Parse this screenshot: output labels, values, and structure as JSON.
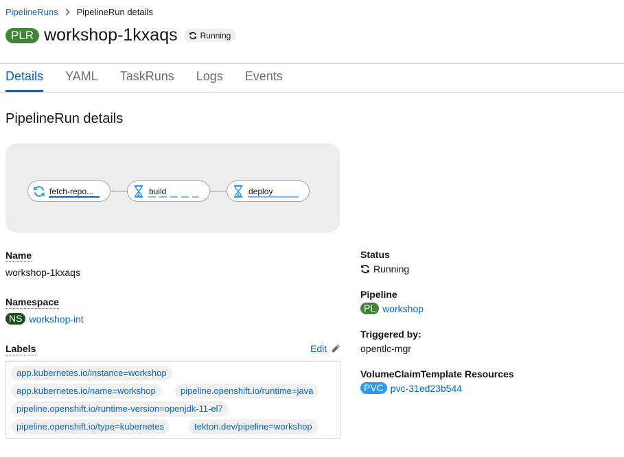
{
  "breadcrumb": {
    "parent": "PipelineRuns",
    "current": "PipelineRun details"
  },
  "header": {
    "badge": "PLR",
    "title": "workshop-1kxaqs",
    "status": "Running"
  },
  "tabs": [
    "Details",
    "YAML",
    "TaskRuns",
    "Logs",
    "Events"
  ],
  "active_tab": "Details",
  "section_title": "PipelineRun details",
  "graph": {
    "nodes": [
      {
        "label": "fetch-repo...",
        "state": "running",
        "icon": "sync-icon"
      },
      {
        "label": "build",
        "state": "pending",
        "icon": "hourglass-icon"
      },
      {
        "label": "deploy",
        "state": "pending",
        "icon": "hourglass-icon"
      }
    ]
  },
  "details": {
    "name_label": "Name",
    "name_value": "workshop-1kxaqs",
    "namespace_label": "Namespace",
    "namespace_badge": "NS",
    "namespace_value": "workshop-int",
    "labels_label": "Labels",
    "edit_label": "Edit",
    "labels": [
      "app.kubernetes.io/instance=workshop",
      "app.kubernetes.io/name=workshop",
      "pipeline.openshift.io/runtime=java",
      "pipeline.openshift.io/runtime-version=openjdk-11-el7",
      "pipeline.openshift.io/type=kubernetes",
      "tekton.dev/pipeline=workshop"
    ]
  },
  "side": {
    "status_label": "Status",
    "status_value": "Running",
    "pipeline_label": "Pipeline",
    "pipeline_badge": "PL",
    "pipeline_value": "workshop",
    "triggered_label": "Triggered by:",
    "triggered_value": "opentlc-mgr",
    "volume_label": "VolumeClaimTemplate Resources",
    "pvc_badge": "PVC",
    "pvc_value": "pvc-31ed23b544"
  },
  "colors": {
    "link": "#0066cc",
    "running_green": "#3e8635",
    "pvc_blue": "#2b9af3"
  }
}
